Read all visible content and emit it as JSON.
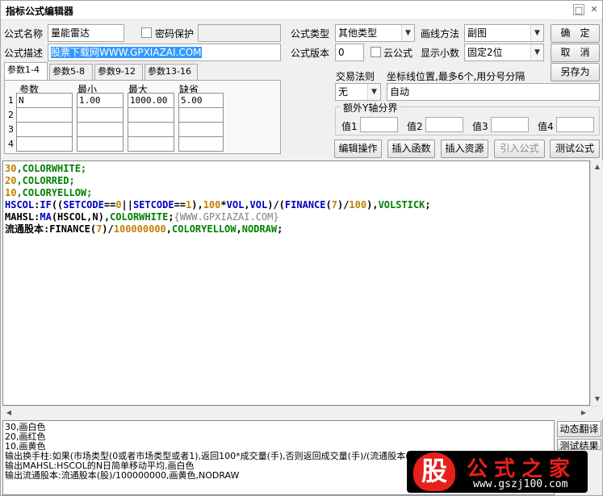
{
  "window": {
    "title": "指标公式编辑器"
  },
  "form": {
    "name_label": "公式名称",
    "name_value": "量能雷达",
    "password_label": "密码保护",
    "desc_label": "公式描述",
    "desc_value": "股票下载网WWW.GPXIAZAI.COM",
    "type_label": "公式类型",
    "type_value": "其他类型",
    "draw_label": "画线方法",
    "draw_value": "副图",
    "version_label": "公式版本",
    "version_value": "0",
    "cloud_label": "云公式",
    "decimal_label": "显示小数",
    "decimal_value": "固定2位",
    "trade_label": "交易法则",
    "trade_value": "无",
    "coord_label": "坐标线位置,最多6个,用分号分隔",
    "coord_value": "自动",
    "yaxis_label": "额外Y轴分界",
    "y1_label": "值1",
    "y2_label": "值2",
    "y3_label": "值3",
    "y4_label": "值4"
  },
  "buttons": {
    "ok": "确　定",
    "cancel": "取　消",
    "save_as": "另存为",
    "edit_op": "编辑操作",
    "insert_func": "插入函数",
    "insert_res": "插入资源",
    "import_formula": "引入公式",
    "test_formula": "测试公式",
    "dynamic_translate": "动态翻译",
    "test_result": "测试结果"
  },
  "tabs": [
    "参数1-4",
    "参数5-8",
    "参数9-12",
    "参数13-16"
  ],
  "params": {
    "headers": [
      "参数",
      "最小",
      "最大",
      "缺省"
    ],
    "rows": [
      {
        "idx": "1",
        "name": "N",
        "min": "1.00",
        "max": "1000.00",
        "default": "5.00"
      },
      {
        "idx": "2",
        "name": "",
        "min": "",
        "max": "",
        "default": ""
      },
      {
        "idx": "3",
        "name": "",
        "min": "",
        "max": "",
        "default": ""
      },
      {
        "idx": "4",
        "name": "",
        "min": "",
        "max": "",
        "default": ""
      }
    ]
  },
  "code": {
    "lines": [
      [
        {
          "t": "30",
          "c": "#c08000"
        },
        {
          "t": ",COLORWHITE;",
          "c": "#008000"
        }
      ],
      [
        {
          "t": "20",
          "c": "#c08000"
        },
        {
          "t": ",COLORRED;",
          "c": "#008000"
        }
      ],
      [
        {
          "t": "10",
          "c": "#c08000"
        },
        {
          "t": ",COLORYELLOW;",
          "c": "#008000"
        }
      ],
      [
        {
          "t": "HSCOL",
          "c": "#0000c0"
        },
        {
          "t": ":",
          "c": "#000000"
        },
        {
          "t": "IF",
          "c": "#0000c0"
        },
        {
          "t": "((",
          "c": "#000000"
        },
        {
          "t": "SETCODE",
          "c": "#0000c0"
        },
        {
          "t": "==",
          "c": "#000000"
        },
        {
          "t": "0",
          "c": "#c08000"
        },
        {
          "t": "||",
          "c": "#000000"
        },
        {
          "t": "SETCODE",
          "c": "#0000c0"
        },
        {
          "t": "==",
          "c": "#000000"
        },
        {
          "t": "1",
          "c": "#c08000"
        },
        {
          "t": "),",
          "c": "#000000"
        },
        {
          "t": "100",
          "c": "#c08000"
        },
        {
          "t": "*",
          "c": "#000000"
        },
        {
          "t": "VOL",
          "c": "#0000c0"
        },
        {
          "t": ",",
          "c": "#000000"
        },
        {
          "t": "VOL",
          "c": "#0000c0"
        },
        {
          "t": ")/(",
          "c": "#000000"
        },
        {
          "t": "FINANCE",
          "c": "#0000c0"
        },
        {
          "t": "(",
          "c": "#000000"
        },
        {
          "t": "7",
          "c": "#c08000"
        },
        {
          "t": ")/",
          "c": "#000000"
        },
        {
          "t": "100",
          "c": "#c08000"
        },
        {
          "t": "),",
          "c": "#000000"
        },
        {
          "t": "VOLSTICK",
          "c": "#008000"
        },
        {
          "t": ";",
          "c": "#000000"
        }
      ],
      [
        {
          "t": "MAHSL",
          "c": "#000000"
        },
        {
          "t": ":",
          "c": "#000000"
        },
        {
          "t": "MA",
          "c": "#0000c0"
        },
        {
          "t": "(HSCOL,N),",
          "c": "#000000"
        },
        {
          "t": "COLORWHITE",
          "c": "#008000"
        },
        {
          "t": ";",
          "c": "#000000"
        },
        {
          "t": "{WWW.GPXIAZAI.COM}",
          "c": "#808080"
        }
      ],
      [
        {
          "t": "流通股本",
          "c": "#000000"
        },
        {
          "t": ":",
          "c": "#000000"
        },
        {
          "t": "FINANCE",
          "c": "#000000"
        },
        {
          "t": "(",
          "c": "#000000"
        },
        {
          "t": "7",
          "c": "#c08000"
        },
        {
          "t": ")/",
          "c": "#000000"
        },
        {
          "t": "100000000",
          "c": "#c08000"
        },
        {
          "t": ",",
          "c": "#000000"
        },
        {
          "t": "COLORYELLOW",
          "c": "#008000"
        },
        {
          "t": ",",
          "c": "#000000"
        },
        {
          "t": "NODRAW",
          "c": "#008000"
        },
        {
          "t": ";",
          "c": "#000000"
        }
      ]
    ]
  },
  "output": {
    "lines": [
      "30,画白色",
      "20,画红色",
      "10,画黄色",
      "输出换手柱:如果(市场类型(0或者市场类型或者1),返回100*成交量(手),否则返回成交量(手)/(流通股本(股)/100)),成交量柱线",
      "输出MAHSL:HSCOL的N日简单移动平均,画白色",
      "输出流通股本:流通股本(股)/100000000,画黄色,NODRAW"
    ]
  },
  "watermark": {
    "logo": "股",
    "name": "公式之家",
    "url": "www.gszj100.com"
  },
  "colors": {
    "accent_red": "#e8201b",
    "code_number": "#c08000",
    "code_keyword": "#0000c0",
    "code_color": "#008000"
  }
}
